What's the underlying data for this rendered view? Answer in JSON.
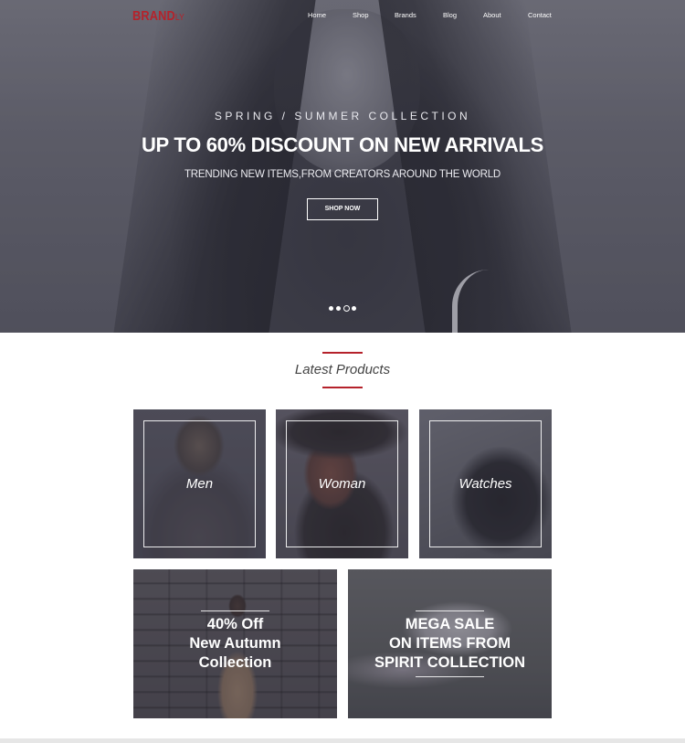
{
  "brand": {
    "name": "BRAND",
    "suffix": "LY",
    "color": "#b5222b"
  },
  "nav": {
    "items": [
      "Home",
      "Shop",
      "Brands",
      "Blog",
      "About",
      "Contact"
    ]
  },
  "hero": {
    "subtitle": "SPRING / SUMMER COLLECTION",
    "title": "UP TO 60% DISCOUNT ON NEW ARRIVALS",
    "description": "TRENDING NEW ITEMS,FROM CREATORS AROUND THE WORLD",
    "cta_label": "SHOP NOW",
    "slides": {
      "count": 4,
      "active_index": 2
    }
  },
  "latest": {
    "title": "Latest Products",
    "categories": [
      "Men",
      "Woman",
      "Watches"
    ]
  },
  "promos": [
    {
      "lines": [
        "40% Off",
        "New Autumn",
        "Collection"
      ]
    },
    {
      "lines": [
        "MEGA SALE",
        "ON ITEMS FROM",
        "SPIRIT COLLECTION"
      ]
    }
  ]
}
